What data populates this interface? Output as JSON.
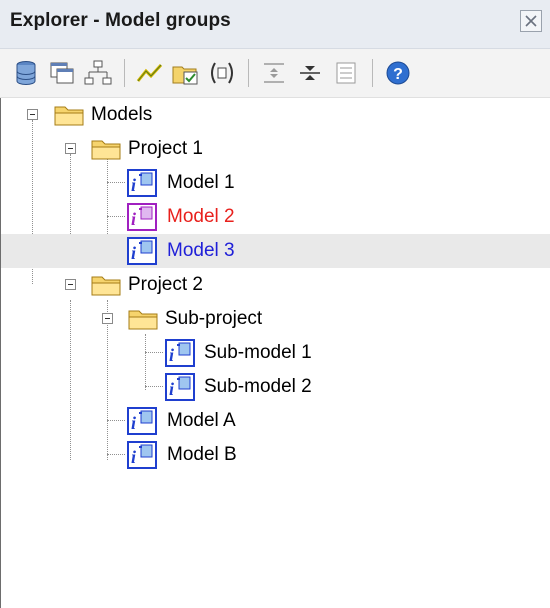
{
  "window": {
    "title": "Explorer - Model groups"
  },
  "colors": {
    "model_red": "#e8201c",
    "model_blue": "#2020d8",
    "icon_blue": "#1f3fcf",
    "icon_purple": "#a020c0"
  },
  "toolbar": {
    "buttons": [
      {
        "icon": "database-icon"
      },
      {
        "icon": "windows-icon"
      },
      {
        "icon": "hierarchy-icon"
      },
      {
        "icon": "zigzag-chart-icon"
      },
      {
        "icon": "folder-check-icon"
      },
      {
        "icon": "parenthesis-icon"
      },
      {
        "icon": "expand-icon"
      },
      {
        "icon": "collapse-icon"
      },
      {
        "icon": "list-icon"
      },
      {
        "icon": "help-icon"
      }
    ]
  },
  "tree": {
    "root": {
      "label": "Models"
    },
    "project1": {
      "label": "Project 1"
    },
    "model1": {
      "label": "Model 1"
    },
    "model2": {
      "label": "Model 2"
    },
    "model3": {
      "label": "Model 3"
    },
    "project2": {
      "label": "Project 2"
    },
    "subproject": {
      "label": "Sub-project"
    },
    "submodel1": {
      "label": "Sub-model 1"
    },
    "submodel2": {
      "label": "Sub-model 2"
    },
    "modelA": {
      "label": "Model A"
    },
    "modelB": {
      "label": "Model B"
    }
  }
}
